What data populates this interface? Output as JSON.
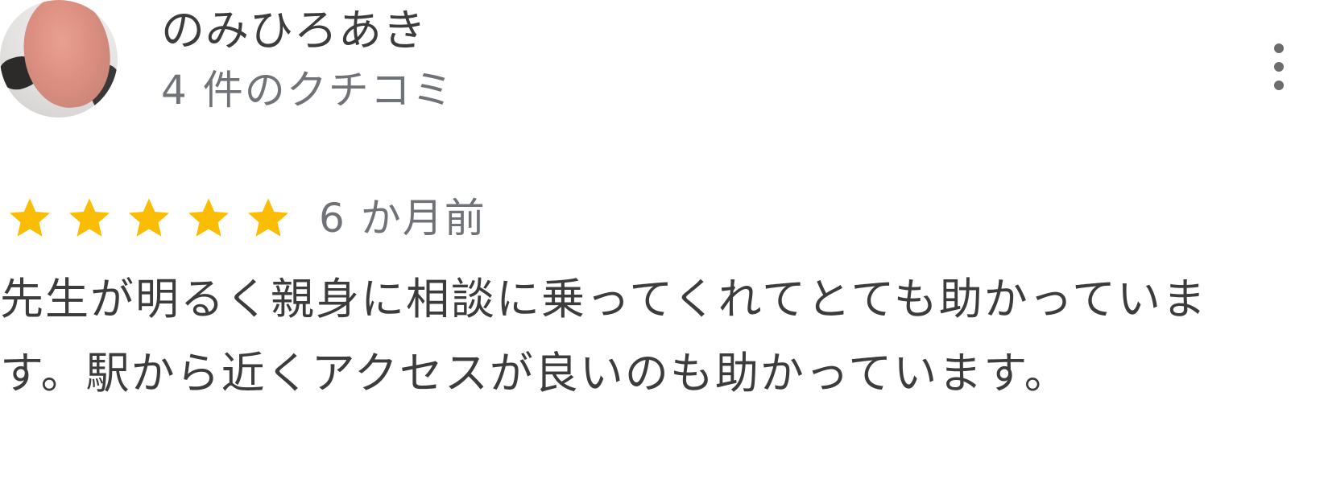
{
  "review": {
    "author_name": "のみひろあき",
    "review_count": "4 件のクチコミ",
    "rating": 5,
    "max_rating": 5,
    "star_color": "#fbbc04",
    "date": "6 か月前",
    "text": "先生が明るく親身に相談に乗ってくれてとても助かっています。駅から近くアクセスが良いのも助かっています。"
  },
  "icons": {
    "more": "more-vertical-icon",
    "star": "star-icon",
    "avatar": "user-avatar"
  }
}
